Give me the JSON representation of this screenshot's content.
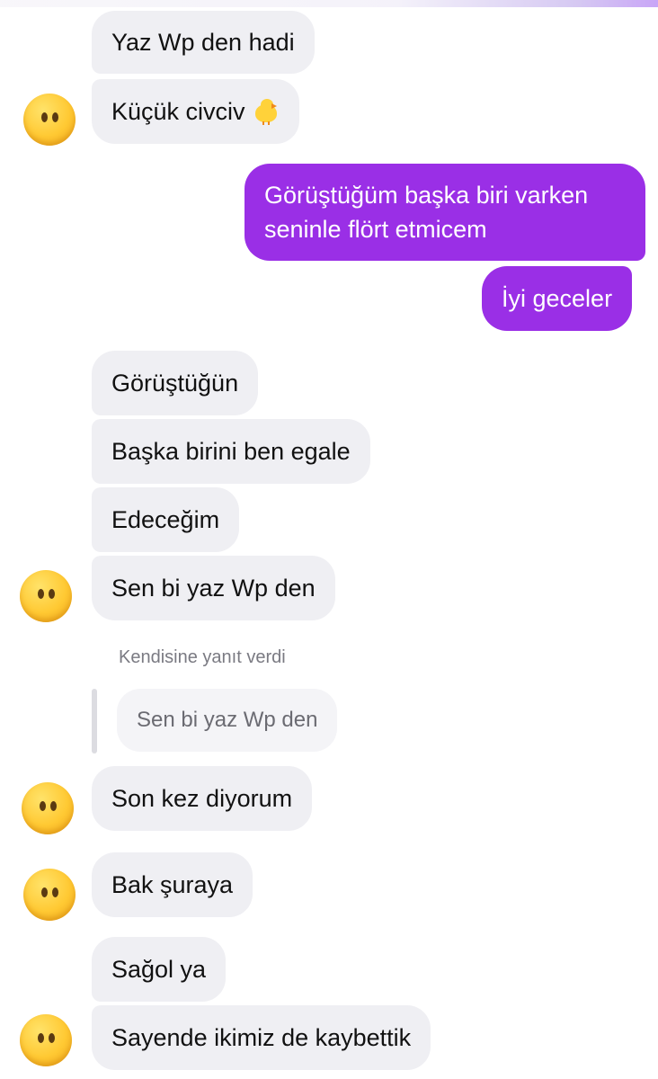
{
  "conversation": {
    "messages": [
      {
        "id": "m1",
        "direction": "incoming",
        "text": "Yaz Wp den hadi"
      },
      {
        "id": "m2",
        "direction": "incoming",
        "text": "Küçük civciv",
        "emoji": "chick-icon"
      },
      {
        "id": "m3",
        "direction": "outgoing",
        "text": "Görüştüğüm başka biri varken seninle flört etmicem"
      },
      {
        "id": "m4",
        "direction": "outgoing",
        "text": "İyi geceler"
      },
      {
        "id": "m5",
        "direction": "incoming",
        "text": "Görüştüğün"
      },
      {
        "id": "m6",
        "direction": "incoming",
        "text": "Başka birini ben egale"
      },
      {
        "id": "m7",
        "direction": "incoming",
        "text": "Edeceğim"
      },
      {
        "id": "m8",
        "direction": "incoming",
        "text": "Sen bi yaz Wp den"
      },
      {
        "id": "m9",
        "direction": "incoming",
        "text": "Son kez diyorum"
      },
      {
        "id": "m10",
        "direction": "incoming",
        "text": "Bak şuraya"
      },
      {
        "id": "m11",
        "direction": "incoming",
        "text": "Sağol ya"
      },
      {
        "id": "m12",
        "direction": "incoming",
        "text": "Sayende ikimiz de kaybettik"
      }
    ],
    "reply_context": {
      "caption": "Kendisine yanıt verdi",
      "quoted_text": "Sen bi yaz Wp den"
    }
  },
  "avatar": {
    "icon": "neutral-face-icon"
  },
  "colors": {
    "incoming_bubble": "#efeff3",
    "outgoing_bubble": "#9a2fe6",
    "incoming_text": "#111111",
    "outgoing_text": "#ffffff",
    "caption_text": "#7a7a82"
  }
}
